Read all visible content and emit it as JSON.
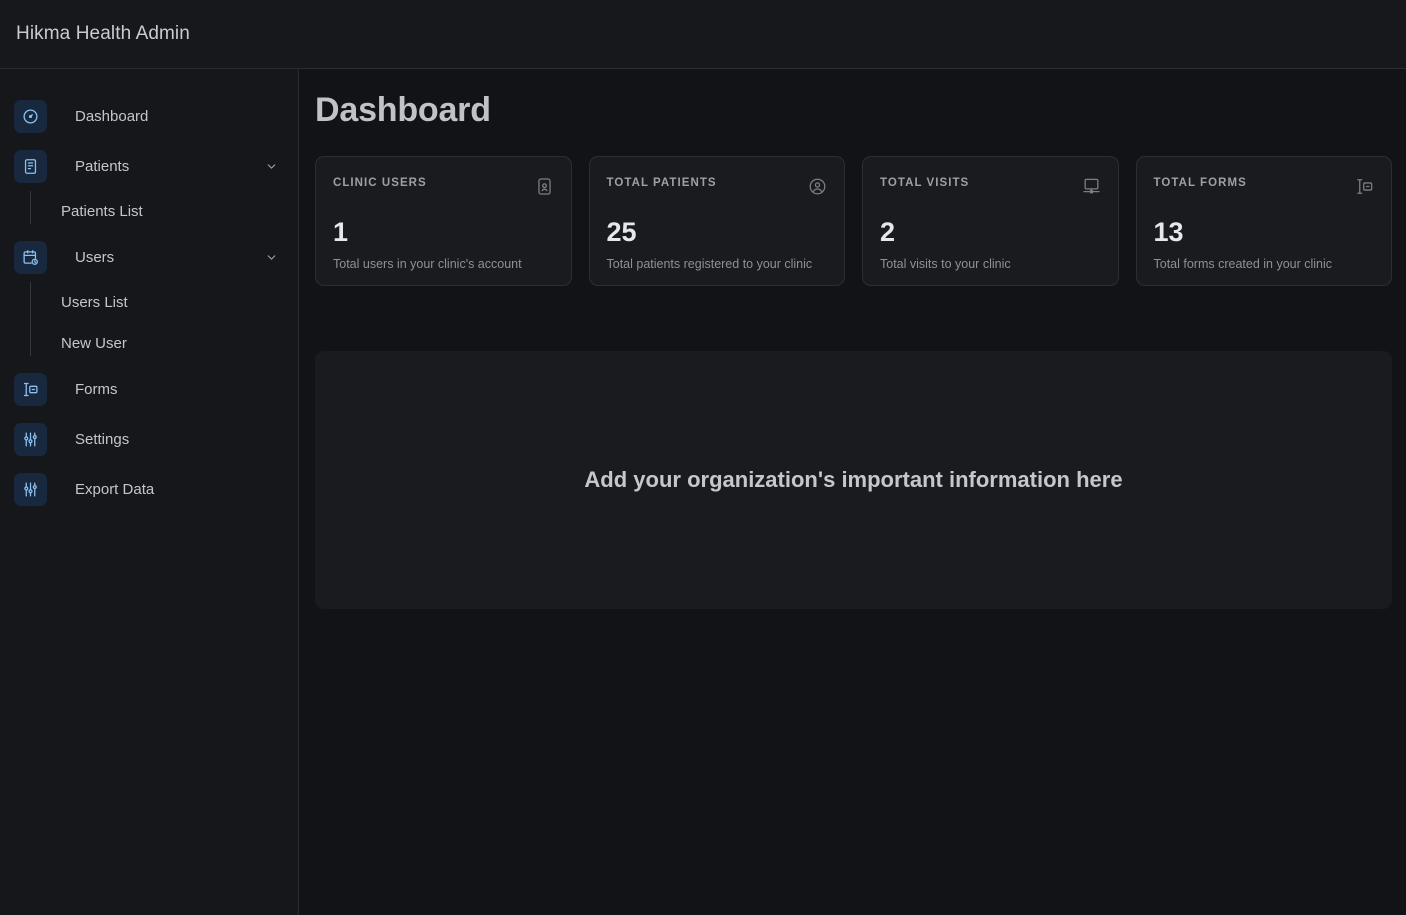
{
  "header": {
    "title": "Hikma Health Admin"
  },
  "sidebar": {
    "items": [
      {
        "label": "Dashboard",
        "icon": "gauge-icon",
        "expandable": false
      },
      {
        "label": "Patients",
        "icon": "document-icon",
        "expandable": true,
        "children": [
          {
            "label": "Patients List"
          }
        ]
      },
      {
        "label": "Users",
        "icon": "calendar-clock-icon",
        "expandable": true,
        "children": [
          {
            "label": "Users List"
          },
          {
            "label": "New User"
          }
        ]
      },
      {
        "label": "Forms",
        "icon": "form-field-icon",
        "expandable": false
      },
      {
        "label": "Settings",
        "icon": "sliders-icon",
        "expandable": false
      },
      {
        "label": "Export Data",
        "icon": "sliders-icon",
        "expandable": false
      }
    ]
  },
  "main": {
    "page_title": "Dashboard",
    "cards": [
      {
        "label": "CLINIC USERS",
        "value": "1",
        "description": "Total users in your clinic's account",
        "icon": "contact-card-icon"
      },
      {
        "label": "TOTAL PATIENTS",
        "value": "25",
        "description": "Total patients registered to your clinic",
        "icon": "user-circle-icon"
      },
      {
        "label": "TOTAL VISITS",
        "value": "2",
        "description": "Total visits to your clinic",
        "icon": "presentation-screen-icon"
      },
      {
        "label": "TOTAL FORMS",
        "value": "13",
        "description": "Total forms created in your clinic",
        "icon": "form-field-icon"
      }
    ],
    "info_panel": {
      "text": "Add your organization's important information here"
    }
  },
  "colors": {
    "page_background": "#121316",
    "panel_background": "#1a1b1e",
    "sidebar_background": "#16171a",
    "border": "#2c2e33",
    "icon_tile": "#18283f",
    "icon_accent": "#8dc2f0",
    "text_primary": "#c3c6cb",
    "text_muted": "#8d9096"
  }
}
